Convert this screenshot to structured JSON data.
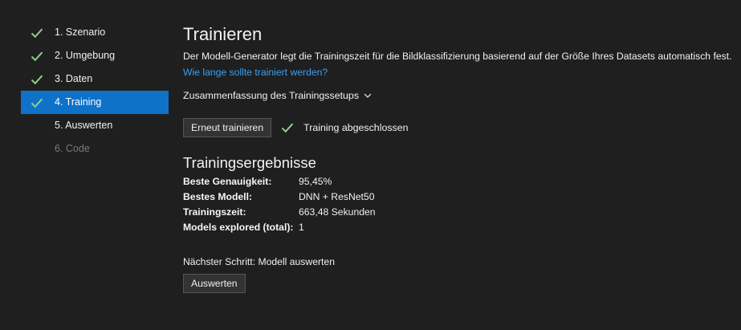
{
  "sidebar": {
    "steps": [
      {
        "label": "1. Szenario",
        "state": "done"
      },
      {
        "label": "2. Umgebung",
        "state": "done"
      },
      {
        "label": "3. Daten",
        "state": "done"
      },
      {
        "label": "4. Training",
        "state": "active"
      },
      {
        "label": "5. Auswerten",
        "state": "pending"
      },
      {
        "label": "6. Code",
        "state": "disabled"
      }
    ]
  },
  "main": {
    "title": "Trainieren",
    "description": "Der Modell-Generator legt die Trainingszeit für die Bildklassifizierung basierend auf der Größe Ihres Datasets automatisch fest.",
    "help_link": "Wie lange sollte trainiert werden?",
    "summary_toggle": "Zusammenfassung des Trainingssetups",
    "retrain_button": "Erneut trainieren",
    "status_text": "Training abgeschlossen",
    "results_title": "Trainingsergebnisse",
    "results": [
      {
        "key": "Beste Genauigkeit:",
        "value": "95,45%"
      },
      {
        "key": "Bestes Modell:",
        "value": "DNN + ResNet50"
      },
      {
        "key": "Trainingszeit:",
        "value": "663,48 Sekunden"
      },
      {
        "key": "Models explored (total):",
        "value": "1"
      }
    ],
    "next_step": "Nächster Schritt: Modell auswerten",
    "evaluate_button": "Auswerten"
  },
  "colors": {
    "background": "#1f1f1f",
    "accent": "#0e72c9",
    "link": "#3aa0f3",
    "check": "#8fcf8a"
  }
}
